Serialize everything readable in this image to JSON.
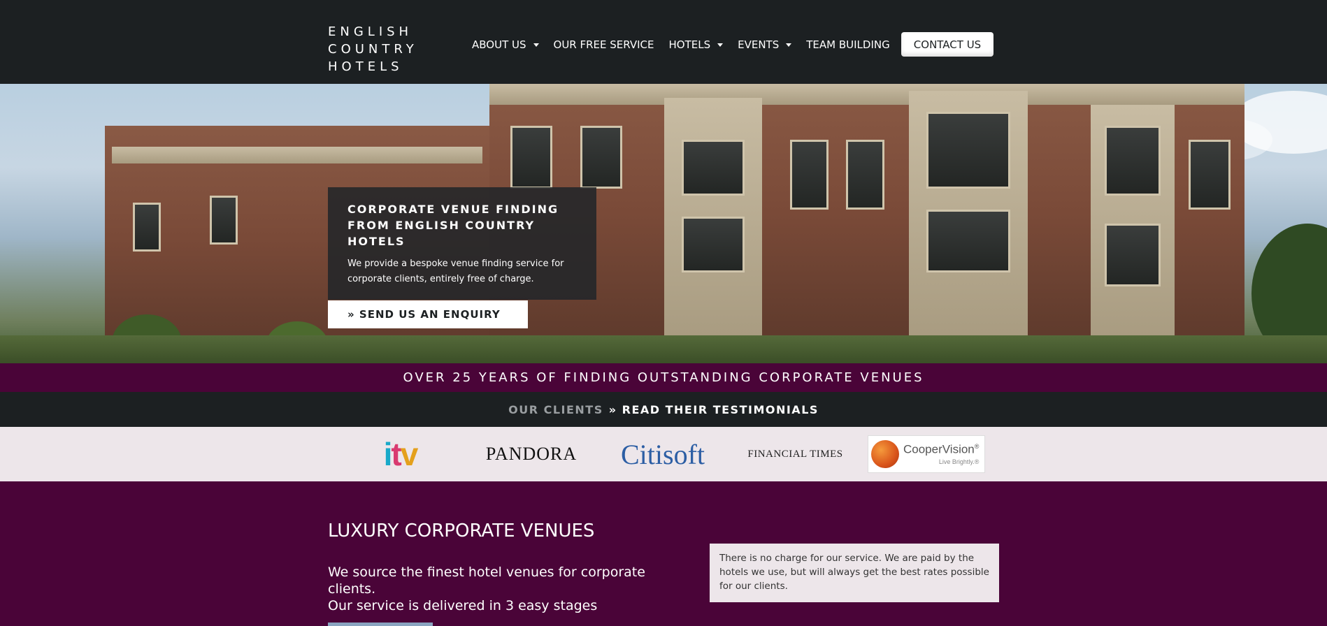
{
  "brand": {
    "line1": "ENGLISH",
    "line2": "COUNTRY",
    "line3": "HOTELS"
  },
  "nav": {
    "items": [
      {
        "label": "ABOUT US",
        "dropdown": true
      },
      {
        "label": "OUR FREE SERVICE",
        "dropdown": false
      },
      {
        "label": "HOTELS",
        "dropdown": true
      },
      {
        "label": "EVENTS",
        "dropdown": true
      },
      {
        "label": "TEAM BUILDING",
        "dropdown": false
      }
    ],
    "contact_label": "CONTACT US"
  },
  "hero": {
    "title": "CORPORATE VENUE FINDING FROM ENGLISH COUNTRY HOTELS",
    "text": "We provide a bespoke venue finding service for corporate clients, entirely free of charge.",
    "cta_label": "» SEND US AN ENQUIRY",
    "thumbnails_count": 4,
    "active_thumbnail": 4
  },
  "banner": {
    "text": "OVER 25 YEARS OF FINDING OUTSTANDING CORPORATE VENUES"
  },
  "clients": {
    "muted": "OUR CLIENTS",
    "link": "» READ THEIR TESTIMONIALS",
    "logos": {
      "itv_i": "i",
      "itv_t": "t",
      "itv_v": "v",
      "pandora": "PANDORA",
      "citisoft": "Citisoft",
      "ft": "FINANCIAL TIMES",
      "cooper_name": "CooperVision",
      "cooper_reg": "®",
      "cooper_tag": "Live Brightly.®"
    }
  },
  "content": {
    "title": "LUXURY CORPORATE VENUES",
    "subtitle_line1": "We source the finest hotel venues for corporate clients.",
    "subtitle_line2": "Our service is delivered in 3 easy stages",
    "info": "There is no charge for our service. We are paid by the hotels we use, but will always get the best rates possible for our clients."
  },
  "colors": {
    "header_bg": "#1c2022",
    "accent_purple": "#4a0438",
    "logos_bg": "#ede6ea"
  }
}
